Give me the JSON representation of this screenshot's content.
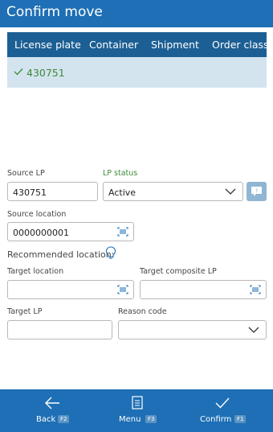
{
  "title": "Confirm move",
  "grid": {
    "columns": [
      "License plate",
      "Container",
      "Shipment",
      "Order class"
    ],
    "rows": [
      {
        "license_plate": "430751"
      }
    ]
  },
  "form": {
    "source_lp": {
      "label": "Source LP",
      "value": "430751"
    },
    "lp_status": {
      "label": "LP status",
      "value": "Active"
    },
    "source_location": {
      "label": "Source location",
      "value": "0000000001"
    },
    "recommended_location": {
      "label": "Recommended location:"
    },
    "target_location": {
      "label": "Target location",
      "value": ""
    },
    "target_composite_lp": {
      "label": "Target composite LP",
      "value": ""
    },
    "target_lp": {
      "label": "Target LP",
      "value": ""
    },
    "reason_code": {
      "label": "Reason code",
      "value": ""
    }
  },
  "bottom_bar": {
    "back": {
      "label": "Back",
      "key": "F2",
      "icon": "arrow-left-icon"
    },
    "menu": {
      "label": "Menu",
      "key": "F3",
      "icon": "menu-icon"
    },
    "confirm": {
      "label": "Confirm",
      "key": "F1",
      "icon": "checkmark-icon"
    }
  },
  "colors": {
    "accent": "#1e6fb5",
    "grid_header": "#1c5f94",
    "selected_row": "#d3e4ef",
    "status_green": "#3f8a3a"
  }
}
